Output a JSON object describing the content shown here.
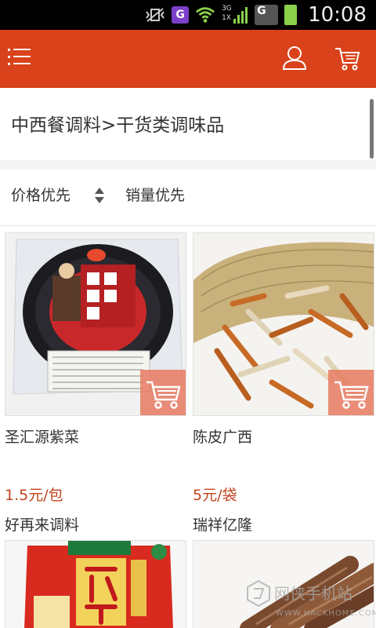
{
  "status_bar": {
    "g_badge": "G",
    "network_label_top": "3G",
    "network_label_bottom": "1X",
    "g2_badge": "G",
    "time": "10:08",
    "icons": [
      "vibrate-icon",
      "g-app-icon",
      "wifi-icon",
      "signal-icon",
      "signal-icon",
      "battery-charging-icon"
    ]
  },
  "header": {
    "accent_color": "#d9421a",
    "icons": [
      "menu-icon",
      "user-icon",
      "cart-icon"
    ]
  },
  "breadcrumb": {
    "text": "中西餐调料>干货类调味品"
  },
  "sort": {
    "price_label": "价格优先",
    "sales_label": "销量优先",
    "sort_icon": "sort-arrows-icon"
  },
  "products": [
    {
      "title": "圣汇源紫菜",
      "price": "1.5元/包",
      "seller": "好再来调料",
      "image_icon": "seaweed-package-image"
    },
    {
      "title": "陈皮广西",
      "price": "5元/袋",
      "seller": "瑞祥亿隆",
      "image_icon": "dried-tangerine-peel-image"
    },
    {
      "title": "",
      "price": "",
      "seller": "",
      "image_icon": "chicken-seasoning-bag-image"
    },
    {
      "title": "",
      "price": "",
      "seller": "",
      "image_icon": "cinnamon-sticks-image"
    }
  ],
  "watermark": {
    "text": "网侠手机站",
    "subtext": "WWW.HACKHOME.COM"
  },
  "colors": {
    "price_color": "#c2451f",
    "cart_badge": "#e67a62"
  }
}
